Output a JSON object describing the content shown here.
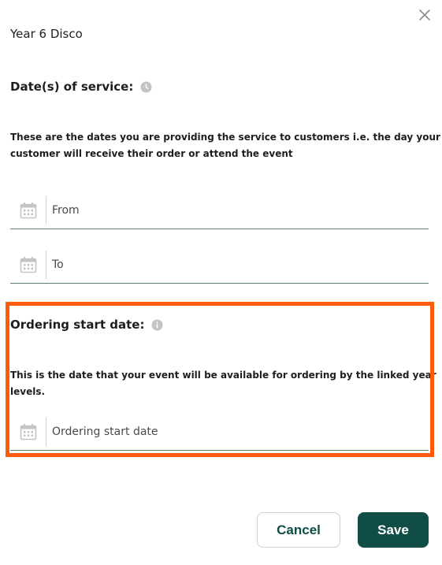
{
  "dialog": {
    "title": "Year 6 Disco",
    "close_icon": "close-icon"
  },
  "service_dates": {
    "label": "Date(s) of service:",
    "label_icon": "clock-icon",
    "description_line1": "These are the dates you are providing the service to customers i.e. the day your",
    "description_line2": "customer will receive their order or attend the event",
    "from_placeholder": "From",
    "to_placeholder": "To",
    "field_icon": "calendar-icon"
  },
  "ordering_start": {
    "label": "Ordering start date:",
    "label_icon": "info-icon",
    "description": "This is the date that your event will be available for ordering by the linked year levels.",
    "placeholder": "Ordering start date",
    "field_icon": "calendar-icon"
  },
  "actions": {
    "cancel_label": "Cancel",
    "save_label": "Save"
  },
  "colors": {
    "accent": "#0f4d46",
    "highlight": "#ff5a0a",
    "field_underline": "#5d7c74",
    "icon_grey": "#c4c4c4"
  }
}
